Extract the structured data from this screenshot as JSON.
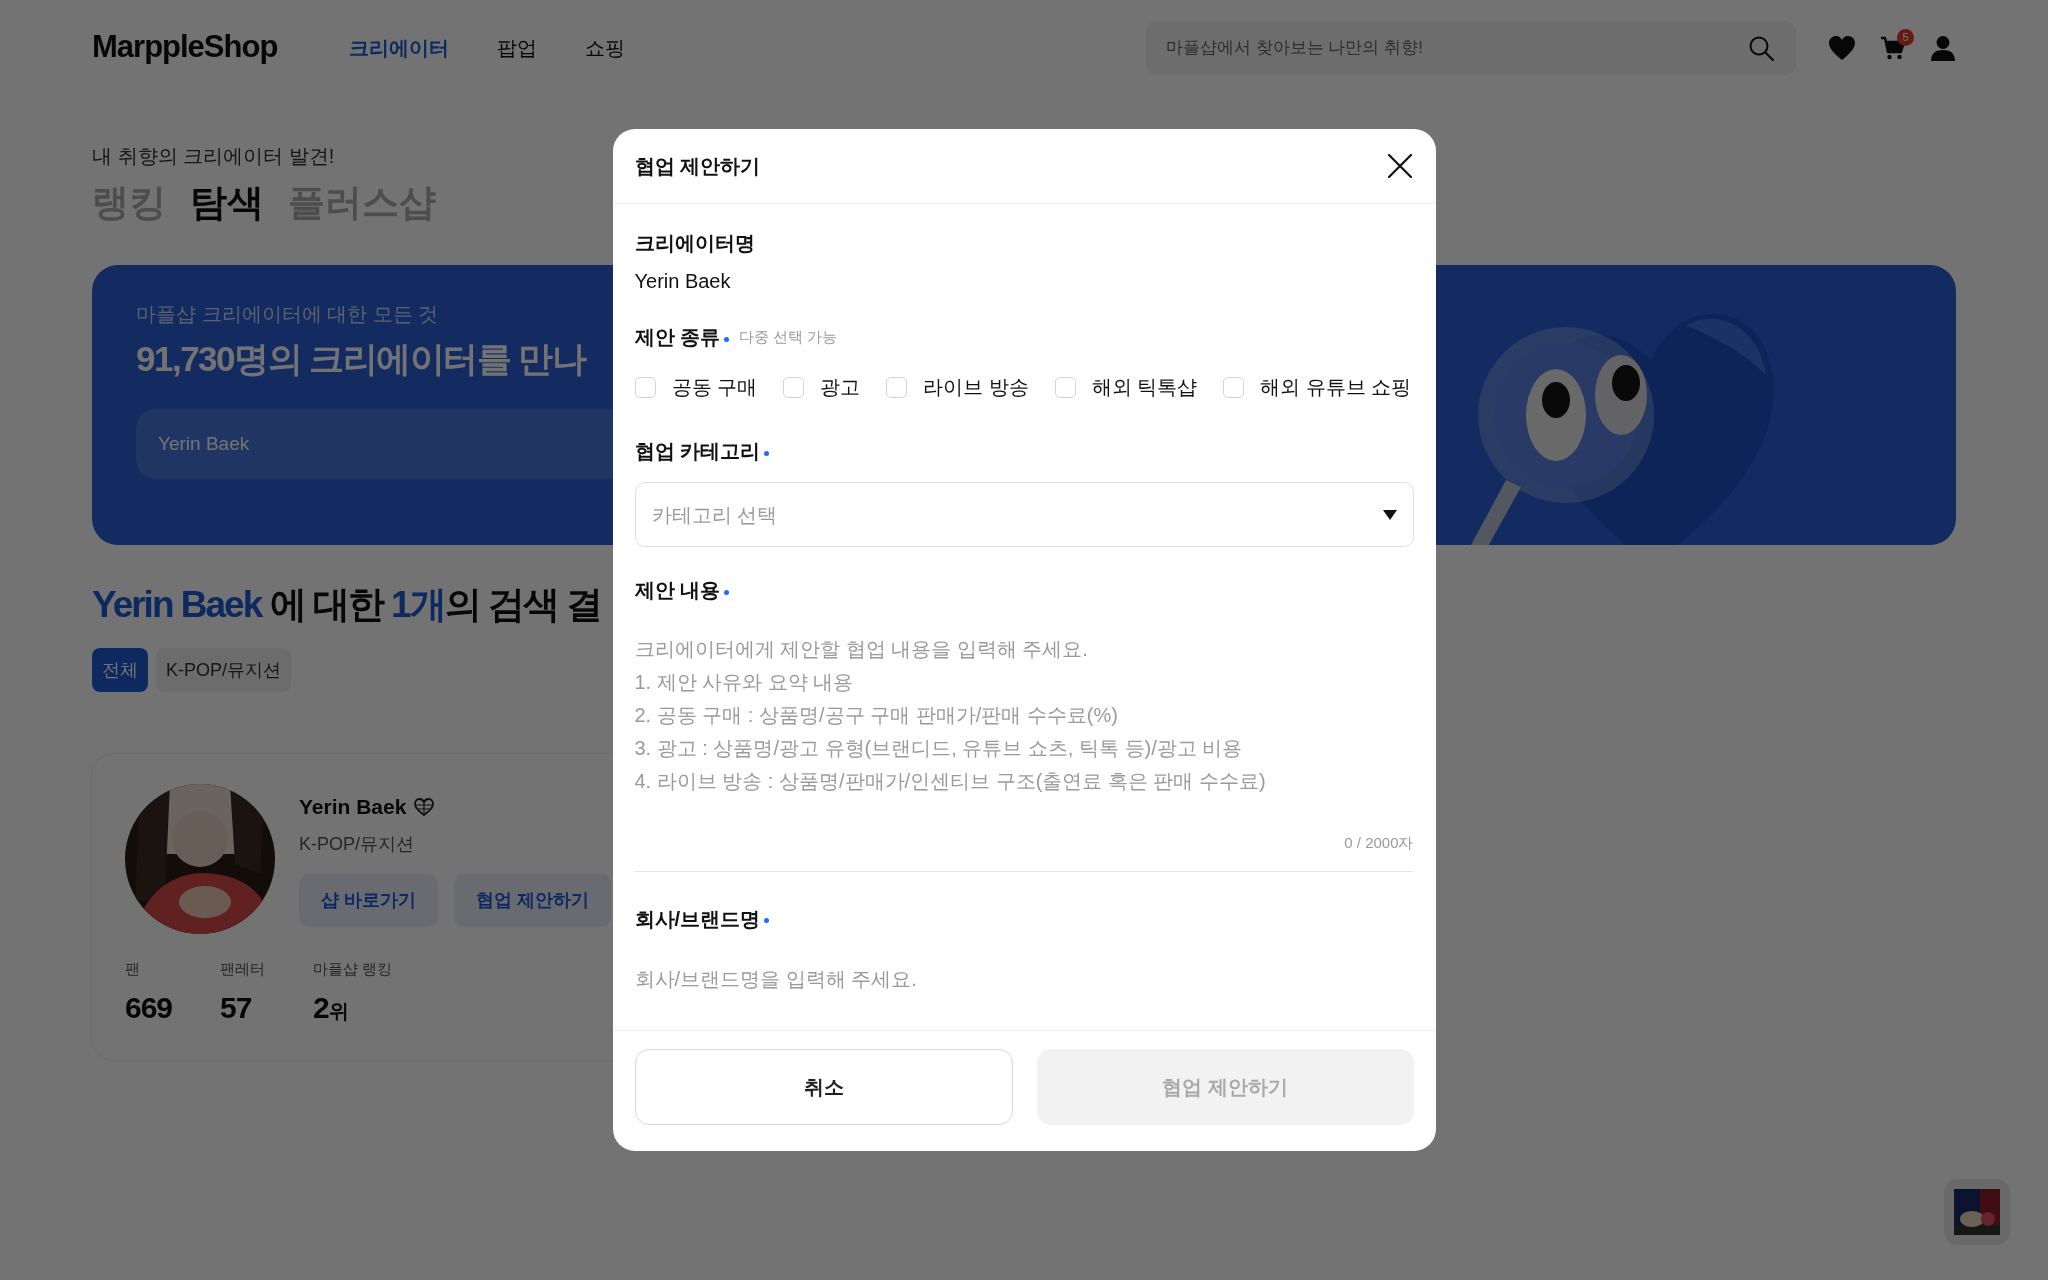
{
  "header": {
    "logo": "MarppleShop",
    "nav": [
      {
        "label": "크리에이터",
        "selected": true
      },
      {
        "label": "팝업",
        "selected": false
      },
      {
        "label": "쇼핑",
        "selected": false
      }
    ],
    "search": {
      "placeholder": "마플샵에서 찾아보는 나만의 취향!"
    },
    "cart_count": "5"
  },
  "page": {
    "eyebrow": "내 취향의 크리에이터 발견!",
    "tabs": [
      {
        "label": "랭킹",
        "selected": false
      },
      {
        "label": "탐색",
        "selected": true
      },
      {
        "label": "플러스샵",
        "selected": false
      }
    ],
    "banner": {
      "subtitle": "마플샵 크리에이터에 대한 모든 것",
      "title": "91,730명의 크리에이터를 만나",
      "search": {
        "value": "Yerin Baek"
      }
    },
    "result_heading": {
      "query": "Yerin Baek",
      "middle": " 에 대한 ",
      "count": "1개",
      "rest": "의 검색 결"
    },
    "filters": [
      {
        "label": "전체",
        "selected": true
      },
      {
        "label": "K-POP/뮤지션",
        "selected": false
      }
    ],
    "creator_card": {
      "name": "Yerin Baek",
      "category": "K-POP/뮤지션",
      "buttons": [
        "샵 바로가기",
        "협업 제안하기"
      ],
      "stats": [
        {
          "label": "팬",
          "value": "669"
        },
        {
          "label": "팬레터",
          "value": "57"
        },
        {
          "label": "마플샵 랭킹",
          "value": "2",
          "unit": "위"
        }
      ]
    }
  },
  "modal": {
    "title": "협업 제안하기",
    "fields": [
      {
        "kind": "text",
        "label": "크리에이터명",
        "required": false,
        "value": "Yerin Baek"
      },
      {
        "kind": "checkboxes",
        "label": "제안 종류",
        "required": true,
        "hint": "다중 선택 가능",
        "options": [
          {
            "label": "공동 구매",
            "checked": false
          },
          {
            "label": "광고",
            "checked": false
          },
          {
            "label": "라이브 방송",
            "checked": false
          },
          {
            "label": "해외 틱톡샵",
            "checked": false
          },
          {
            "label": "해외 유튜브 쇼핑",
            "checked": false
          }
        ]
      },
      {
        "kind": "select",
        "label": "협업 카테고리",
        "required": true,
        "placeholder": "카테고리 선택"
      },
      {
        "kind": "textarea",
        "label": "제안 내용",
        "required": true,
        "placeholder": "크리에이터에게 제안할 협업 내용을 입력해 주세요.\n1. 제안 사유와 요약 내용\n2. 공동 구매 : 상품명/공구 구매 판매가/판매 수수료(%)\n3. 광고 : 상품명/광고 유형(브랜디드, 유튜브 쇼츠, 틱톡 등)/광고 비용\n4. 라이브 방송 : 상품명/판매가/인센티브 구조(출연료 혹은 판매 수수료)",
        "counter": "0 / 2000자"
      },
      {
        "kind": "input",
        "label": "회사/브랜드명",
        "required": true,
        "placeholder": "회사/브랜드명을 입력해 주세요."
      }
    ],
    "buttons": [
      {
        "label": "취소",
        "kind": "cancel",
        "disabled": false
      },
      {
        "label": "협업 제안하기",
        "kind": "submit",
        "disabled": true
      }
    ]
  }
}
